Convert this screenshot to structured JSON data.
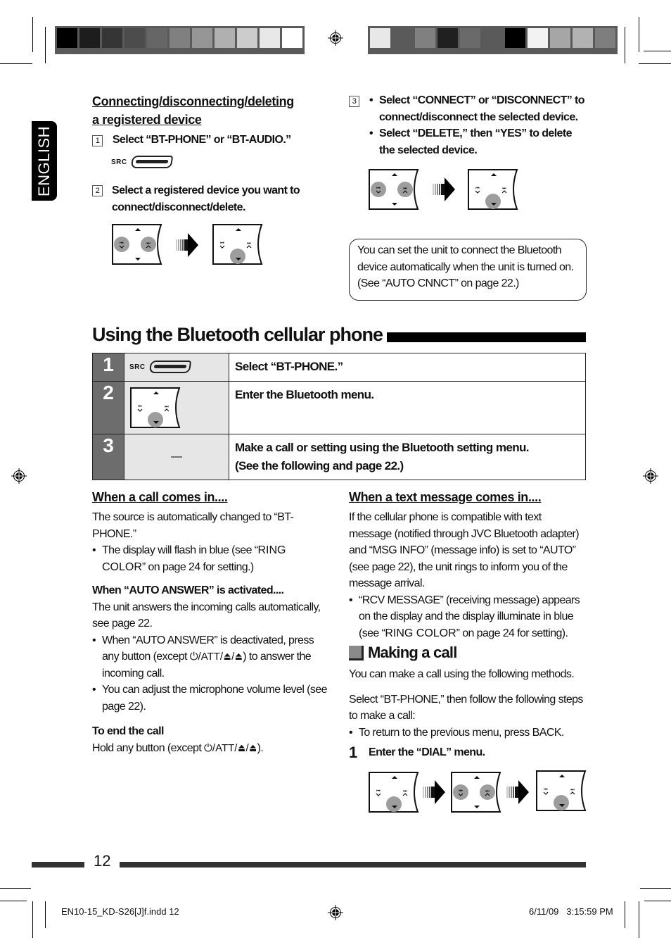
{
  "print_marks": {
    "left_bar_shades": [
      "#000000",
      "#1d1d1d",
      "#353535",
      "#4c4c4c",
      "#666666",
      "#808080",
      "#969696",
      "#b0b0b0",
      "#cccccc",
      "#e8e8e8",
      "#ffffff"
    ],
    "right_bar_shades": [
      "#e8e8e8",
      "#5a5a5a",
      "#808080",
      "#202020",
      "#6a6a6a",
      "#5a5a5a",
      "#000000",
      "#f2f2f2",
      "#a6a6a6",
      "#b2b2b2",
      "#7e7e7e"
    ]
  },
  "language_tab": "ENGLISH",
  "connect_section": {
    "heading": "Connecting/disconnecting/deleting a registered device",
    "step1": {
      "num": "1",
      "text": "Select “BT-PHONE” or “BT-AUDIO.”",
      "src_label": "SRC"
    },
    "step2": {
      "num": "2",
      "text": "Select a registered device you want to connect/disconnect/delete."
    },
    "step3": {
      "num": "3",
      "bullets": [
        "Select “CONNECT” or “DISCONNECT” to connect/disconnect the selected device.",
        "Select “DELETE,” then “YES” to delete the selected device."
      ]
    },
    "note": "You can set the unit to connect the Bluetooth device automatically when the unit is turned on. (See “AUTO CNNCT” on page 22.)"
  },
  "main_title": "Using the Bluetooth cellular phone",
  "steps_table": [
    {
      "num": "1",
      "icon": "src-button",
      "src_label": "SRC",
      "text": "Select “BT-PHONE.”"
    },
    {
      "num": "2",
      "icon": "control-pad-down",
      "text": "Enter the Bluetooth menu."
    },
    {
      "num": "3",
      "icon_text": "—",
      "text_line1": "Make a call or setting using the Bluetooth setting menu.",
      "text_line2": "(See the following and page 22.)"
    }
  ],
  "call_in": {
    "heading": "When a call comes in....",
    "intro": "The source is automatically changed to “BT-PHONE.”",
    "bullet1_a": "The display will flash in blue (see “",
    "bullet1_wide": "RING COLOR",
    "bullet1_b": "” on page 24 for setting.)",
    "auto_heading": "When “AUTO ANSWER” is activated....",
    "auto_text": "The unit answers the incoming calls automatically, see page 22.",
    "bullet2_a": "When “AUTO ANSWER” is deactivated, press any button (except ",
    "except_keys": "⏻/ATT/⏏/⏏",
    "bullet2_b": ") to answer the incoming call.",
    "bullet3": "You can adjust the microphone volume level (see page 22).",
    "end_heading": "To end the call",
    "end_text_a": "Hold any button (except ",
    "end_text_b": ")."
  },
  "text_in": {
    "heading": "When a text message comes in....",
    "body": "If the cellular phone is compatible with text message (notified through JVC Bluetooth adapter) and “MSG INFO” (message info) is set to “AUTO” (see page 22), the unit rings to inform you of the message arrival.",
    "bullet_a": "“RCV MESSAGE” (receiving message) appears on the display and the display illuminate in blue (see “",
    "bullet_wide": "RING COLOR",
    "bullet_b": "” on page 24 for setting)."
  },
  "making_call": {
    "heading": "Making a call",
    "intro": "You can make a call using the following methods.",
    "select_text": "Select “BT-PHONE,” then follow the following steps to make a call:",
    "bullet": "To return to the previous menu, press BACK.",
    "step1_num": "1",
    "step1_text": "Enter the “DIAL” menu."
  },
  "page_number": "12",
  "footer": {
    "file": "EN10-15_KD-S26[J]f.indd   12",
    "timestamp": "6/11/09   3:15:59 PM"
  }
}
